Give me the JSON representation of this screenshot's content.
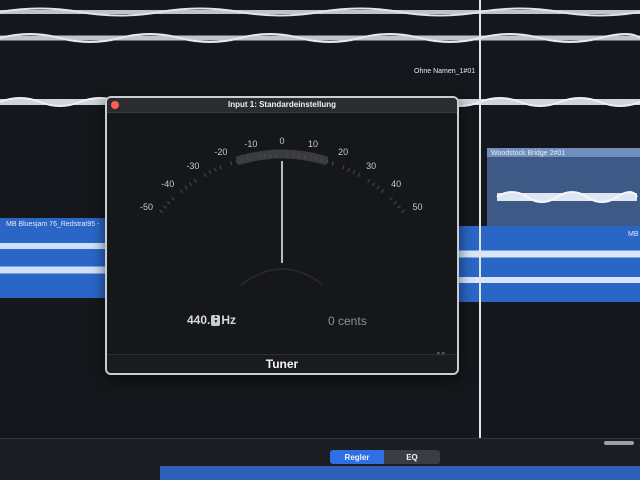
{
  "window": {
    "title": "Input 1: Standardeinstellung",
    "close_color": "#ff5c56"
  },
  "tuner": {
    "scale_labels": [
      "-50",
      "-40",
      "-30",
      "-20",
      "-10",
      "0",
      "10",
      "20",
      "30",
      "40",
      "50"
    ],
    "reference_frequency": "440.",
    "frequency_unit": "Hz",
    "cents_readout": "0 cents",
    "mode_badge": "M",
    "plugin_name": "Tuner",
    "needle_cents": 0
  },
  "tracks": {
    "region_top_right": "Ohne Namen_1#01",
    "region_woodstock": "Woodstock Bridge 2#01",
    "region_mb_left": "MB Bluesjam 76_Redstrat95 -",
    "region_mb_right": "MB"
  },
  "bottom_tabs": {
    "regler": "Regler",
    "eq": "EQ"
  },
  "colors": {
    "region_blue": "#2a66c6",
    "region_steel": "#3d5a86",
    "tab_active": "#2f6fe4",
    "waveform": "#dfe3ea"
  }
}
